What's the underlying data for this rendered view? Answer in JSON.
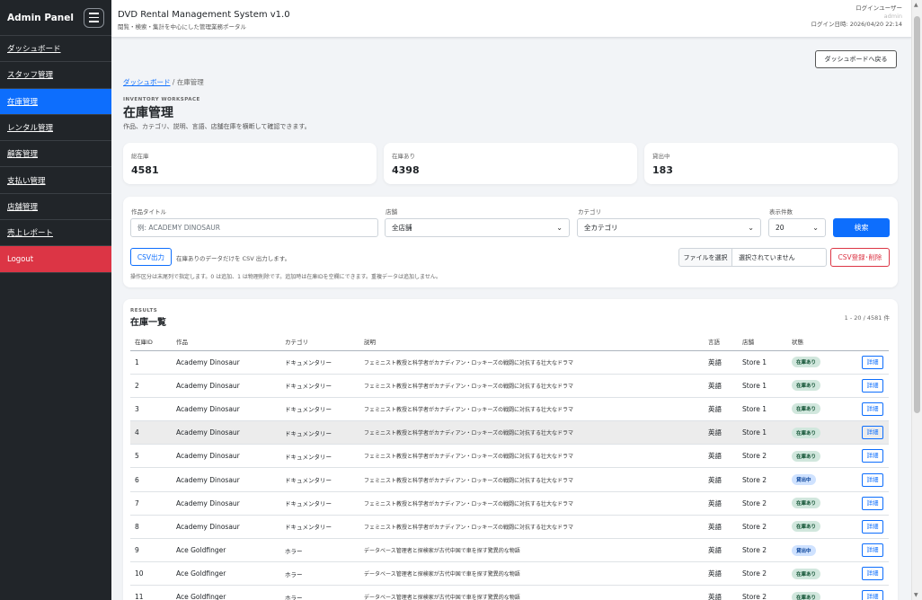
{
  "sidebar": {
    "brand": "Admin Panel",
    "items": [
      {
        "label": "ダッシュボード"
      },
      {
        "label": "スタッフ管理"
      },
      {
        "label": "在庫管理"
      },
      {
        "label": "レンタル管理"
      },
      {
        "label": "顧客管理"
      },
      {
        "label": "支払い管理"
      },
      {
        "label": "店舗管理"
      },
      {
        "label": "売上レポート"
      }
    ],
    "logout": "Logout",
    "active_color": "#0d6efd",
    "logout_color": "#dc3545"
  },
  "header": {
    "title": "DVD Rental Management System v1.0",
    "subtitle": "閲覧・検索・集計を中心にした管理業務ポータル",
    "login_user_label": "ログインユーザー",
    "login_user": "admin",
    "login_time": "ログイン日時: 2026/04/20 22:14"
  },
  "back_button": "ダッシュボードへ戻る",
  "breadcrumb": {
    "home": "ダッシュボード",
    "separator": "/",
    "current": "在庫管理"
  },
  "page": {
    "eyebrow": "INVENTORY WORKSPACE",
    "title": "在庫管理",
    "description": "作品、カテゴリ、説明、言語、店舗在庫を横断して確認できます。"
  },
  "stats": [
    {
      "label": "総在庫",
      "value": "4581"
    },
    {
      "label": "在庫あり",
      "value": "4398"
    },
    {
      "label": "貸出中",
      "value": "183"
    }
  ],
  "filters": {
    "title_label": "作品タイトル",
    "title_placeholder": "例: ACADEMY DINOSAUR",
    "store_label": "店舗",
    "store_value": "全店舗",
    "category_label": "カテゴリ",
    "category_value": "全カテゴリ",
    "limit_label": "表示件数",
    "limit_value": "20",
    "search_button": "検索",
    "csv_export_button": "CSV出力",
    "csv_export_note": "在庫ありのデータだけを CSV 出力します。",
    "file_button": "ファイルを選択",
    "file_name": "選択されていません",
    "csv_import_button": "CSV登録･削除",
    "operation_note": "操作区分は末尾列で指定します。0 は追加、1 は物理削除です。追加時は在庫IDを空欄にできます。重複データは追加しません。"
  },
  "results": {
    "eyebrow": "RESULTS",
    "title": "在庫一覧",
    "count": "1 - 20 / 4581 件",
    "columns": [
      "在庫ID",
      "作品",
      "カテゴリ",
      "説明",
      "言語",
      "店舗",
      "状態",
      ""
    ],
    "detail_label": "詳細",
    "rows": [
      {
        "id": "1",
        "title": "Academy Dinosaur",
        "category": "ドキュメンタリー",
        "description": "フェミニスト教授と科学者がカナディアン・ロッキーズの戦闘に対抗する壮大なドラマ",
        "language": "英語",
        "store": "Store 1",
        "status": "在庫あり",
        "status_type": "in"
      },
      {
        "id": "2",
        "title": "Academy Dinosaur",
        "category": "ドキュメンタリー",
        "description": "フェミニスト教授と科学者がカナディアン・ロッキーズの戦闘に対抗する壮大なドラマ",
        "language": "英語",
        "store": "Store 1",
        "status": "在庫あり",
        "status_type": "in"
      },
      {
        "id": "3",
        "title": "Academy Dinosaur",
        "category": "ドキュメンタリー",
        "description": "フェミニスト教授と科学者がカナディアン・ロッキーズの戦闘に対抗する壮大なドラマ",
        "language": "英語",
        "store": "Store 1",
        "status": "在庫あり",
        "status_type": "in"
      },
      {
        "id": "4",
        "title": "Academy Dinosaur",
        "category": "ドキュメンタリー",
        "description": "フェミニスト教授と科学者がカナディアン・ロッキーズの戦闘に対抗する壮大なドラマ",
        "language": "英語",
        "store": "Store 1",
        "status": "在庫あり",
        "status_type": "in"
      },
      {
        "id": "5",
        "title": "Academy Dinosaur",
        "category": "ドキュメンタリー",
        "description": "フェミニスト教授と科学者がカナディアン・ロッキーズの戦闘に対抗する壮大なドラマ",
        "language": "英語",
        "store": "Store 2",
        "status": "在庫あり",
        "status_type": "in"
      },
      {
        "id": "6",
        "title": "Academy Dinosaur",
        "category": "ドキュメンタリー",
        "description": "フェミニスト教授と科学者がカナディアン・ロッキーズの戦闘に対抗する壮大なドラマ",
        "language": "英語",
        "store": "Store 2",
        "status": "貸出中",
        "status_type": "out"
      },
      {
        "id": "7",
        "title": "Academy Dinosaur",
        "category": "ドキュメンタリー",
        "description": "フェミニスト教授と科学者がカナディアン・ロッキーズの戦闘に対抗する壮大なドラマ",
        "language": "英語",
        "store": "Store 2",
        "status": "在庫あり",
        "status_type": "in"
      },
      {
        "id": "8",
        "title": "Academy Dinosaur",
        "category": "ドキュメンタリー",
        "description": "フェミニスト教授と科学者がカナディアン・ロッキーズの戦闘に対抗する壮大なドラマ",
        "language": "英語",
        "store": "Store 2",
        "status": "在庫あり",
        "status_type": "in"
      },
      {
        "id": "9",
        "title": "Ace Goldfinger",
        "category": "ホラー",
        "description": "データベース管理者と探検家が古代中国で車を探す驚異的な物語",
        "language": "英語",
        "store": "Store 2",
        "status": "貸出中",
        "status_type": "out"
      },
      {
        "id": "10",
        "title": "Ace Goldfinger",
        "category": "ホラー",
        "description": "データベース管理者と探検家が古代中国で車を探す驚異的な物語",
        "language": "英語",
        "store": "Store 2",
        "status": "在庫あり",
        "status_type": "in"
      },
      {
        "id": "11",
        "title": "Ace Goldfinger",
        "category": "ホラー",
        "description": "データベース管理者と探検家が古代中国で車を探す驚異的な物語",
        "language": "英語",
        "store": "Store 2",
        "status": "在庫あり",
        "status_type": "in"
      }
    ],
    "highlighted_row": "4"
  }
}
